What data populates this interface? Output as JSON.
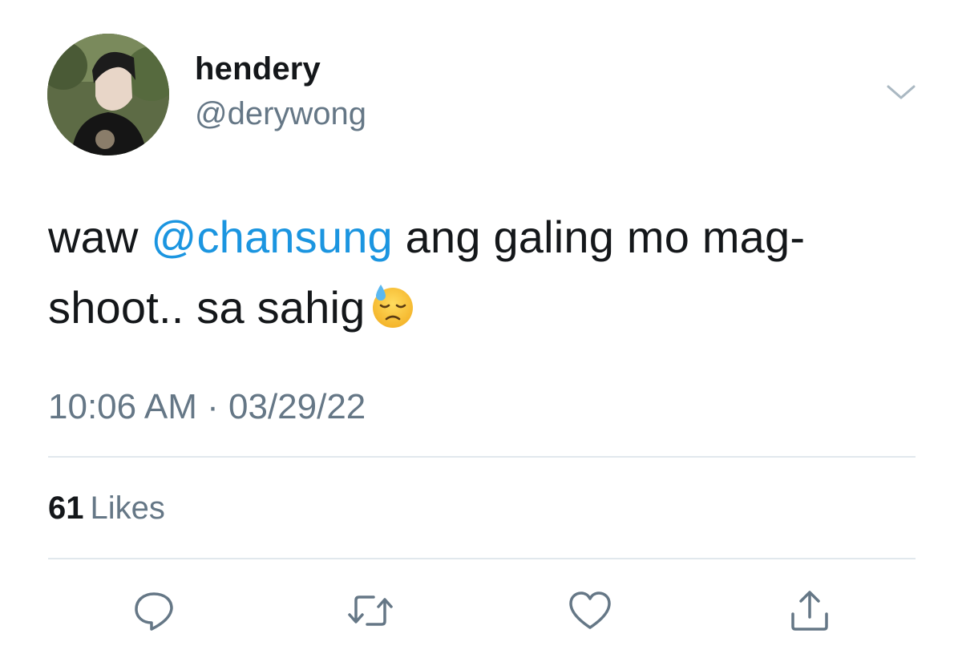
{
  "author": {
    "display_name": "hendery",
    "handle": "@derywong",
    "avatar_icon": "profile-photo"
  },
  "tweet": {
    "text_before": "waw ",
    "mention": "@chansung",
    "text_after": " ang galing mo mag-shoot.. sa sahig",
    "emoji": "downcast-face-with-sweat",
    "timestamp": "10:06 AM · 03/29/22"
  },
  "stats": {
    "likes_count": "61",
    "likes_label": "Likes"
  },
  "actions": [
    {
      "name": "reply",
      "icon": "reply-icon"
    },
    {
      "name": "retweet",
      "icon": "retweet-icon"
    },
    {
      "name": "like",
      "icon": "heart-icon"
    },
    {
      "name": "share",
      "icon": "share-icon"
    }
  ],
  "colors": {
    "text": "#14171a",
    "secondary": "#657786",
    "link": "#1b95e0",
    "divider": "#e1e8ed"
  }
}
